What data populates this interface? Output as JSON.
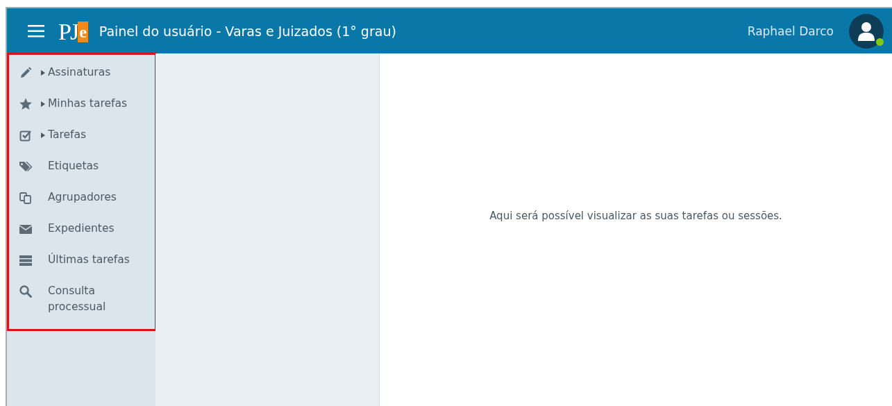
{
  "header": {
    "logo": {
      "main": "PJ",
      "accent": "e"
    },
    "title": "Painel do usuário - Varas e Juizados (1° grau)",
    "user": {
      "name": "Raphael Darco",
      "online": true
    }
  },
  "sidebar": {
    "highlighted": true,
    "items": [
      {
        "label": "Assinaturas",
        "expandable": true
      },
      {
        "label": "Minhas tarefas",
        "expandable": true
      },
      {
        "label": "Tarefas",
        "expandable": true
      },
      {
        "label": "Etiquetas",
        "expandable": false
      },
      {
        "label": "Agrupadores",
        "expandable": false
      },
      {
        "label": "Expedientes",
        "expandable": false
      },
      {
        "label": "Últimas tarefas",
        "expandable": false
      },
      {
        "label": "Consulta processual",
        "expandable": false
      }
    ]
  },
  "content": {
    "message": "Aqui será possível visualizar as suas tarefas ou sessões."
  }
}
